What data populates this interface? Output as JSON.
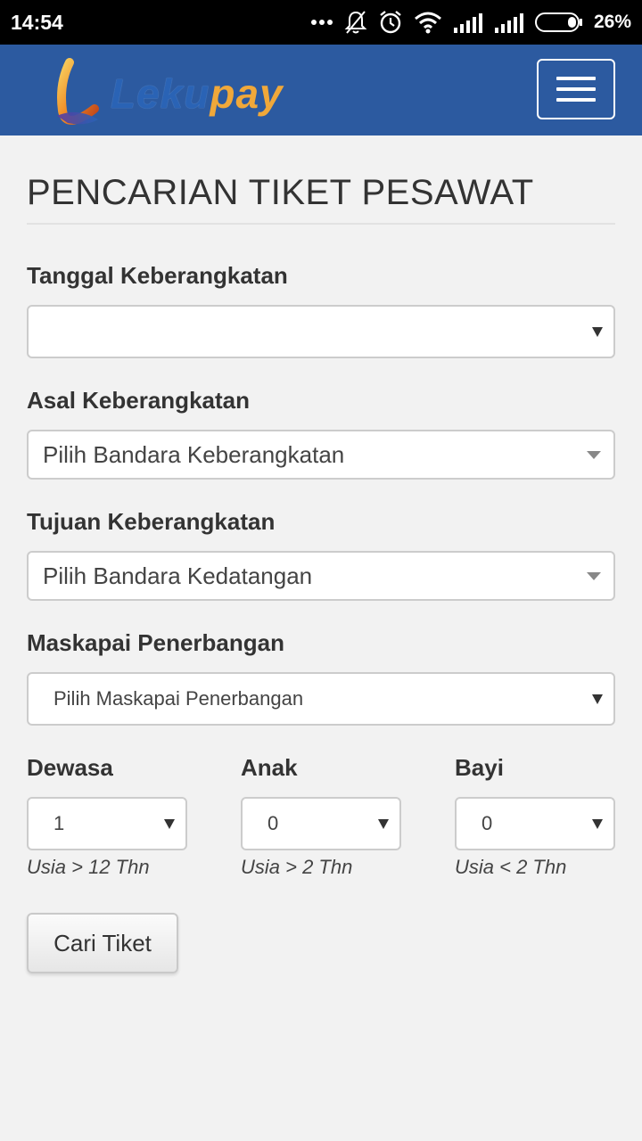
{
  "status_bar": {
    "time": "14:54",
    "battery": "26%",
    "icons": [
      "more-dots-icon",
      "bell-off-icon",
      "alarm-icon",
      "wifi-icon",
      "signal-icon",
      "signal-icon",
      "battery-icon"
    ]
  },
  "navbar": {
    "logo_text_1": "Leku",
    "logo_text_2": "pay",
    "menu_icon": "hamburger-icon",
    "brand_color": "#2c5aa0"
  },
  "page": {
    "title": "PENCARIAN TIKET PESAWAT"
  },
  "form": {
    "date": {
      "label": "Tanggal Keberangkatan",
      "value": ""
    },
    "origin": {
      "label": "Asal Keberangkatan",
      "value": "Pilih Bandara Keberangkatan"
    },
    "destination": {
      "label": "Tujuan Keberangkatan",
      "value": "Pilih Bandara Kedatangan"
    },
    "airline": {
      "label": "Maskapai Penerbangan",
      "value": "Pilih Maskapai Penerbangan"
    },
    "adult": {
      "label": "Dewasa",
      "value": "1",
      "hint": "Usia > 12 Thn"
    },
    "child": {
      "label": "Anak",
      "value": "0",
      "hint": "Usia > 2 Thn"
    },
    "infant": {
      "label": "Bayi",
      "value": "0",
      "hint": "Usia < 2 Thn"
    },
    "submit_label": "Cari Tiket"
  }
}
